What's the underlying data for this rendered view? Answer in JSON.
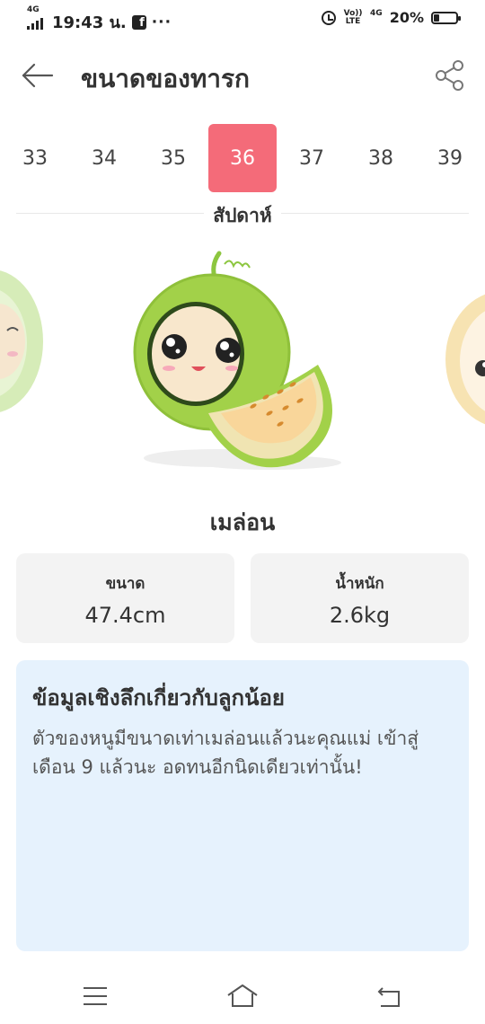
{
  "status_bar": {
    "network": "4G",
    "time": "19:43 น.",
    "notification_icons": [
      "facebook-icon"
    ],
    "more_dots": "···",
    "volte": "Vo)) LTE",
    "data_type": "4G",
    "battery_percent": "20%",
    "battery_level": 0.2
  },
  "header": {
    "title": "ขนาดของทารก",
    "back_icon": "arrow-left-icon",
    "share_icon": "share-icon"
  },
  "weeks": {
    "items": [
      "33",
      "34",
      "35",
      "36",
      "37",
      "38",
      "39"
    ],
    "selected": "36",
    "caption": "สัปดาห์"
  },
  "fruit": {
    "name": "เมล่อน",
    "illustration": "melon-character-icon",
    "accent_color": "#f46b79"
  },
  "stats": {
    "size_label": "ขนาด",
    "size_value": "47.4cm",
    "weight_label": "น้ำหนัก",
    "weight_value": "2.6kg"
  },
  "insight": {
    "title": "ข้อมูลเชิงลึกเกี่ยวกับลูกน้อย",
    "body": "ตัวของหนูมีขนาดเท่าเมล่อนแล้วนะคุณแม่ เข้าสู่เดือน 9 แล้วนะ อดทนอีกนิดเดียวเท่านั้น!"
  },
  "nav_bar": {
    "menu_icon": "menu-icon",
    "home_icon": "home-icon",
    "back_icon": "back-icon"
  }
}
